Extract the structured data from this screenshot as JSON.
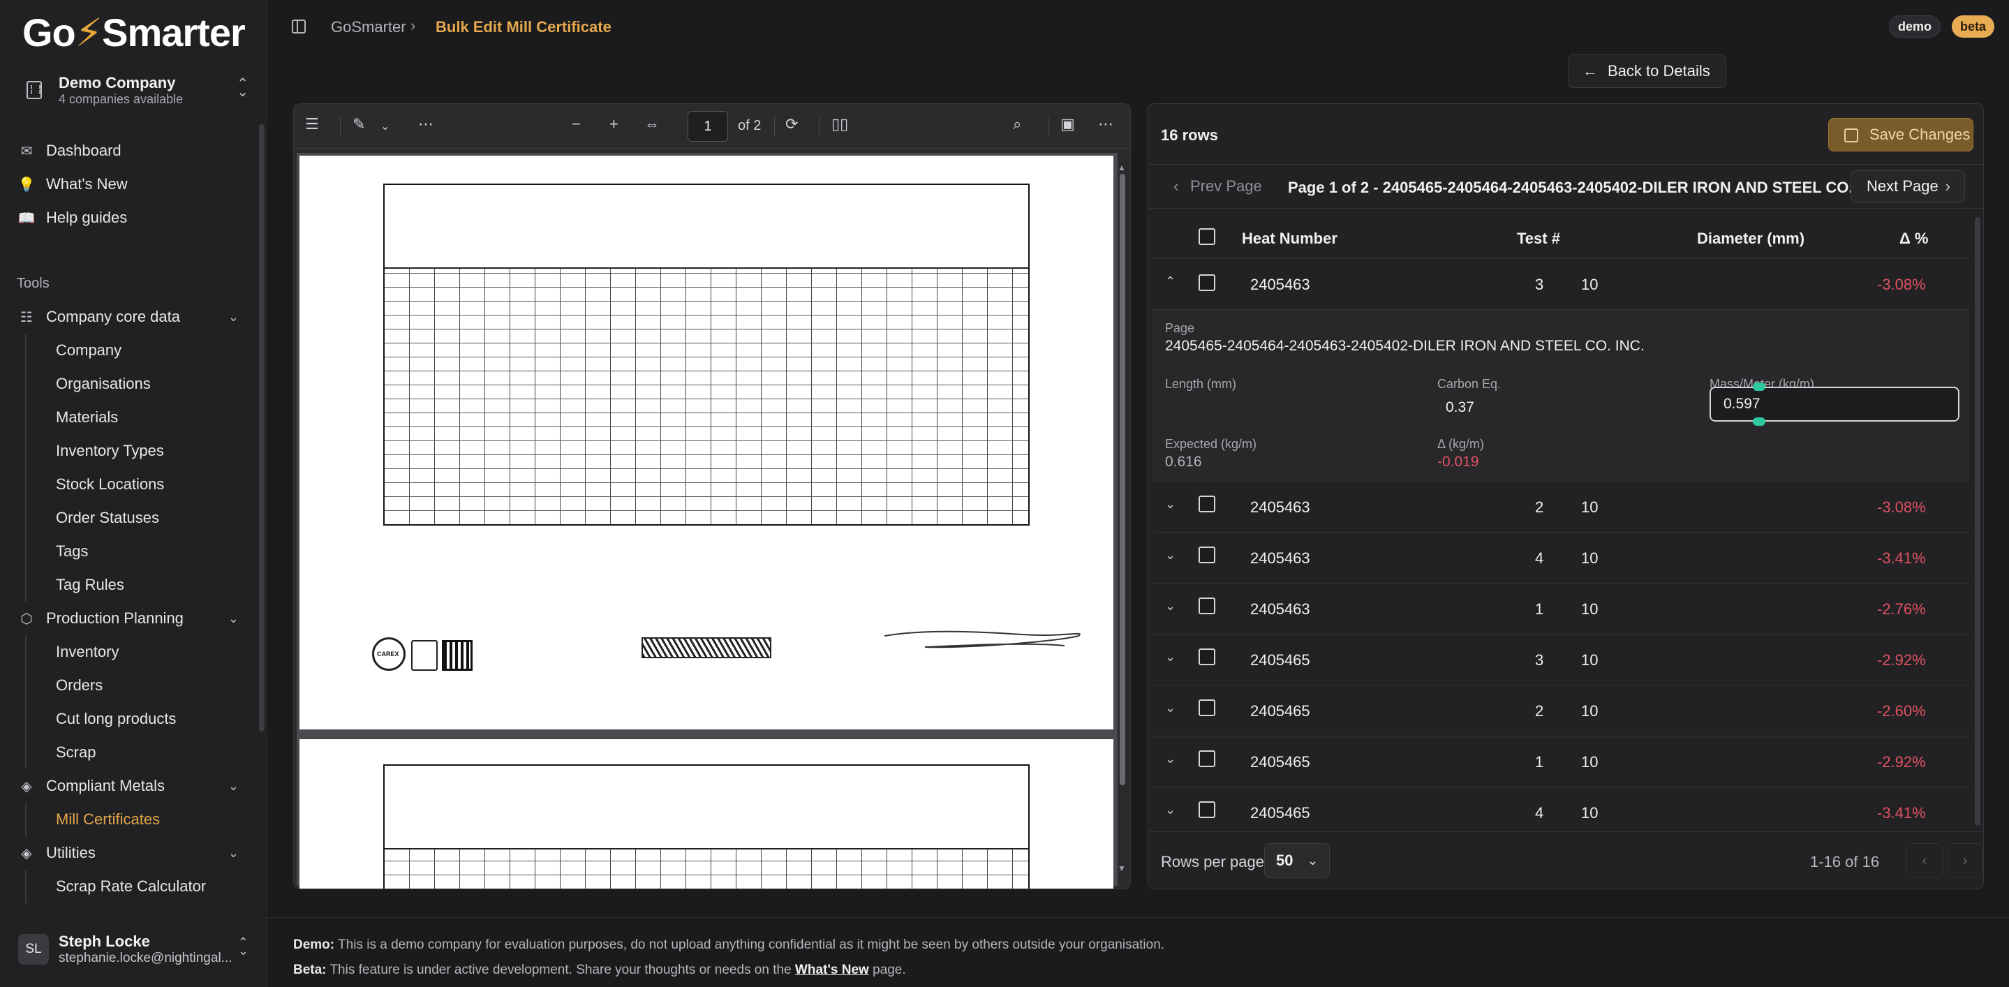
{
  "app": {
    "logo_pre": "Go",
    "logo_post": "Smarter"
  },
  "company": {
    "name": "Demo Company",
    "sub": "4 companies available"
  },
  "nav": {
    "main": [
      {
        "label": "Dashboard",
        "icon": "mail-icon"
      },
      {
        "label": "What's New",
        "icon": "lightbulb-icon"
      },
      {
        "label": "Help guides",
        "icon": "book-icon"
      }
    ],
    "tools_title": "Tools",
    "groups": [
      {
        "label": "Company core data",
        "icon": "database-icon",
        "items": [
          "Company",
          "Organisations",
          "Materials",
          "Inventory Types",
          "Stock Locations",
          "Order Statuses",
          "Tags",
          "Tag Rules"
        ]
      },
      {
        "label": "Production Planning",
        "icon": "box-icon",
        "items": [
          "Inventory",
          "Orders",
          "Cut long products",
          "Scrap"
        ]
      },
      {
        "label": "Compliant Metals",
        "icon": "layers-icon",
        "items": [
          "Mill Certificates"
        ]
      },
      {
        "label": "Utilities",
        "icon": "layers-icon",
        "items": [
          "Scrap Rate Calculator"
        ]
      }
    ]
  },
  "user": {
    "initials": "SL",
    "name": "Steph Locke",
    "email": "stephanie.locke@nightingal..."
  },
  "topbar": {
    "crumb_root": "GoSmarter",
    "crumb_current": "Bulk Edit Mill Certificate",
    "tag_demo": "demo",
    "tag_beta": "beta",
    "back_label": "Back to Details"
  },
  "pdf": {
    "page_value": "1",
    "page_of": "of 2"
  },
  "panel": {
    "rows_count": "16 rows",
    "save_label": "Save Changes",
    "prev_label": "Prev Page",
    "next_label": "Next Page",
    "page_info": "Page 1 of 2 - 2405465-2405464-2405463-2405402-DILER IRON AND STEEL CO. INC.",
    "columns": [
      "Heat Number",
      "Test #",
      "Diameter (mm)",
      "Δ %"
    ],
    "expanded": {
      "heat": "2405463",
      "test": "3",
      "diameter": "10",
      "delta": "-3.08%",
      "page_label": "Page",
      "page_value": "2405465-2405464-2405463-2405402-DILER IRON AND STEEL CO. INC.",
      "length_label": "Length (mm)",
      "carbon_label": "Carbon Eq.",
      "carbon_value": "0.37",
      "mass_label": "Mass/Meter (kg/m)",
      "mass_value": "0.597",
      "expected_label": "Expected (kg/m)",
      "expected_value": "0.616",
      "delta_label": "Δ (kg/m)",
      "delta_value": "-0.019"
    },
    "rows": [
      {
        "heat": "2405463",
        "test": "2",
        "diameter": "10",
        "delta": "-3.08%"
      },
      {
        "heat": "2405463",
        "test": "4",
        "diameter": "10",
        "delta": "-3.41%"
      },
      {
        "heat": "2405463",
        "test": "1",
        "diameter": "10",
        "delta": "-2.76%"
      },
      {
        "heat": "2405465",
        "test": "3",
        "diameter": "10",
        "delta": "-2.92%"
      },
      {
        "heat": "2405465",
        "test": "2",
        "diameter": "10",
        "delta": "-2.60%"
      },
      {
        "heat": "2405465",
        "test": "1",
        "diameter": "10",
        "delta": "-2.92%"
      },
      {
        "heat": "2405465",
        "test": "4",
        "diameter": "10",
        "delta": "-3.41%"
      }
    ],
    "rows_per_page_label": "Rows per page",
    "rows_per_page_value": "50",
    "range": "1-16 of 16"
  },
  "notes": {
    "demo_label": "Demo:",
    "demo_text": " This is a demo company for evaluation purposes, do not upload anything confidential as it might be seen by others outside your organisation.",
    "beta_label": "Beta:",
    "beta_text": " This feature is under active development. Share your thoughts or needs on the ",
    "beta_link": "What's New",
    "beta_tail": " page."
  },
  "colors": {
    "accent": "#e5a84c",
    "negative": "#e05262",
    "bg": "#1b1b1d"
  }
}
